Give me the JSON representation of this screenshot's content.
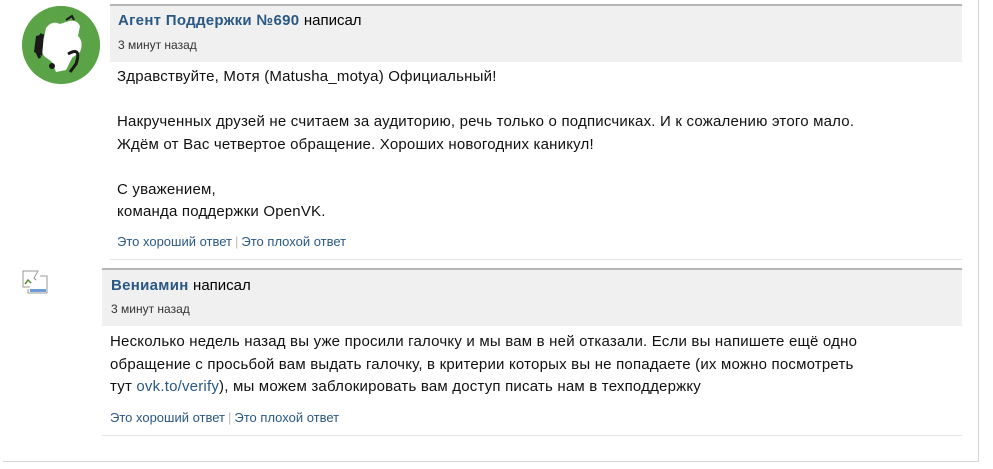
{
  "posts": [
    {
      "author": "Агент Поддержки №690",
      "action": "написал",
      "time": "3 минут назад",
      "body": [
        "Здравствуйте, Мотя (Matusha_motya) Официальный!",
        "",
        "Накрученных друзей не считаем за аудиторию, речь только о подписчиках. И к сожалению этого мало.",
        "Ждём от Вас четвертое обращение. Хороших новогодних каникул!",
        "",
        "С уважением,",
        "команда поддержки OpenVK."
      ],
      "good_label": "Это хороший ответ",
      "separator": "|",
      "bad_label": "Это плохой ответ",
      "avatar_icon": "support-agent-avatar-icon"
    },
    {
      "author": "Вениамин",
      "action": "написал",
      "time": "3 минут назад",
      "body_line1": "Несколько недель назад вы уже просили галочку и мы вам в ней отказали. Если вы напишете ещё одно",
      "body_line2": "обращение с просьбой вам выдать галочку, в критерии которых вы не попадаете (их можно посмотреть",
      "body_line3_pre": "тут ",
      "body_link": "ovk.to/verify",
      "body_line3_post": "), мы можем заблокировать вам доступ писать нам в техподдержку",
      "good_label": "Это хороший ответ",
      "separator": "|",
      "bad_label": "Это плохой ответ",
      "avatar_icon": "broken-image-icon"
    }
  ],
  "colors": {
    "link": "#2a5885",
    "header_bg": "#f0f0f0",
    "header_border": "#b7b7b7",
    "avatar_green": "#5aa447"
  }
}
